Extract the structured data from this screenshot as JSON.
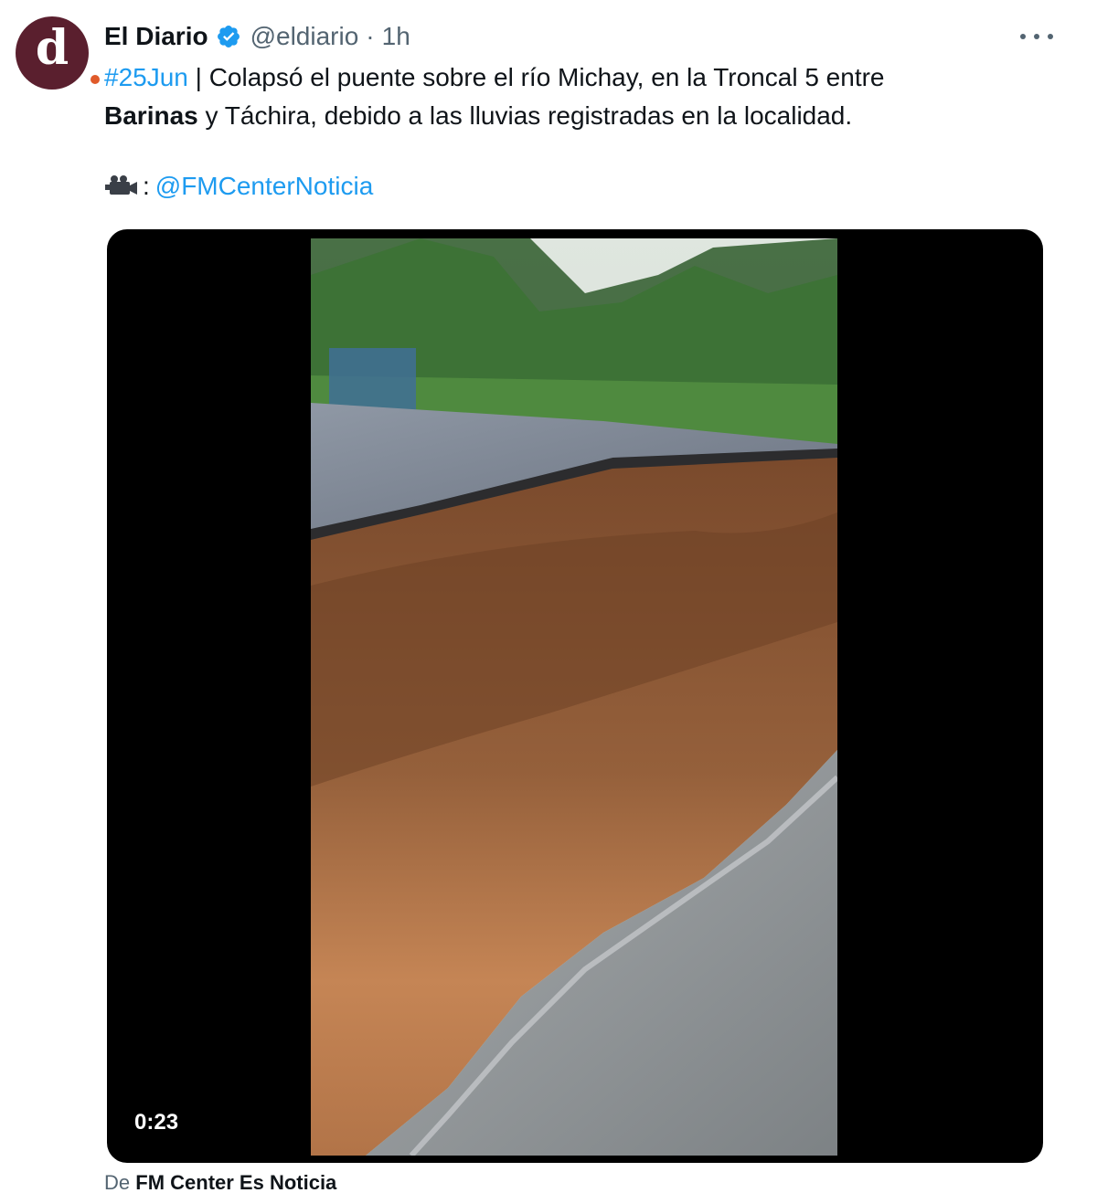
{
  "tweet": {
    "author_name": "El Diario",
    "handle": "@eldiario",
    "separator": "·",
    "time": "1h",
    "avatar_letter": "d",
    "text_hashtag": "#25Jun",
    "text_part1": " | Colapsó el puente sobre el río Michay, en la Troncal 5 entre",
    "text_bold": "Barinas",
    "text_part2": " y Táchira, debido a las lluvias registradas en la localidad.",
    "credit_colon": ":",
    "credit_mention": "@FMCenterNoticia"
  },
  "media": {
    "duration": "0:23"
  },
  "source": {
    "prefix": "De ",
    "name": "FM Center Es Noticia"
  },
  "icons": {
    "verified": "verified-badge-icon",
    "more": "more-options-icon",
    "camera": "video-camera-icon"
  },
  "colors": {
    "accent": "#1d9bf0",
    "avatar_bg": "#5a1f2e",
    "avatar_dot": "#e05a2a",
    "secondary_text": "#536471"
  }
}
